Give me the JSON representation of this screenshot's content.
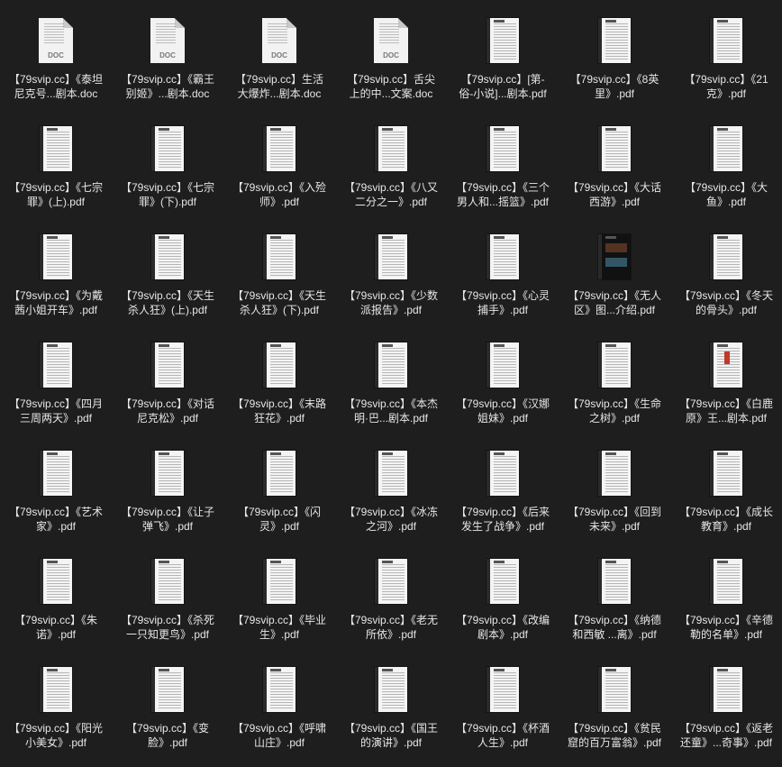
{
  "files": [
    {
      "name": "【79svip.cc】《泰坦\n尼克号...剧本.doc",
      "type": "doc",
      "tag": "DOC"
    },
    {
      "name": "【79svip.cc】《霸王\n别姬》...剧本.doc",
      "type": "doc",
      "tag": "DOC"
    },
    {
      "name": "【79svip.cc】生活\n大爆炸...剧本.doc",
      "type": "doc",
      "tag": "DOC"
    },
    {
      "name": "【79svip.cc】舌尖\n上的中...文案.doc",
      "type": "doc",
      "tag": "DOC"
    },
    {
      "name": "【79svip.cc】[第-\n俗-小说]...剧本.pdf",
      "type": "pdf"
    },
    {
      "name": "【79svip.cc】《8英\n里》.pdf",
      "type": "pdf"
    },
    {
      "name": "【79svip.cc】《21\n克》.pdf",
      "type": "pdf"
    },
    {
      "name": "【79svip.cc】《七宗\n罪》(上).pdf",
      "type": "pdf"
    },
    {
      "name": "【79svip.cc】《七宗\n罪》(下).pdf",
      "type": "pdf"
    },
    {
      "name": "【79svip.cc】《入殓\n师》.pdf",
      "type": "pdf"
    },
    {
      "name": "【79svip.cc】《八又\n二分之一》.pdf",
      "type": "pdf"
    },
    {
      "name": "【79svip.cc】《三个\n男人和...摇篮》.pdf",
      "type": "pdf"
    },
    {
      "name": "【79svip.cc】《大话\n西游》.pdf",
      "type": "pdf"
    },
    {
      "name": "【79svip.cc】《大\n鱼》.pdf",
      "type": "pdf"
    },
    {
      "name": "【79svip.cc】《为戴\n茜小姐开车》.pdf",
      "type": "pdf"
    },
    {
      "name": "【79svip.cc】《天生\n杀人狂》(上).pdf",
      "type": "pdf"
    },
    {
      "name": "【79svip.cc】《天生\n杀人狂》(下).pdf",
      "type": "pdf"
    },
    {
      "name": "【79svip.cc】《少数\n派报告》.pdf",
      "type": "pdf"
    },
    {
      "name": "【79svip.cc】《心灵\n捕手》.pdf",
      "type": "pdf"
    },
    {
      "name": "【79svip.cc】《无人\n区》图...介绍.pdf",
      "type": "pdf",
      "variant": "dark"
    },
    {
      "name": "【79svip.cc】《冬天\n的骨头》.pdf",
      "type": "pdf"
    },
    {
      "name": "【79svip.cc】《四月\n三周两天》.pdf",
      "type": "pdf"
    },
    {
      "name": "【79svip.cc】《对话\n尼克松》.pdf",
      "type": "pdf"
    },
    {
      "name": "【79svip.cc】《末路\n狂花》.pdf",
      "type": "pdf"
    },
    {
      "name": "【79svip.cc】《本杰\n明·巴...剧本.pdf",
      "type": "pdf"
    },
    {
      "name": "【79svip.cc】《汉娜\n姐妹》.pdf",
      "type": "pdf"
    },
    {
      "name": "【79svip.cc】《生命\n之树》.pdf",
      "type": "pdf"
    },
    {
      "name": "【79svip.cc】《白鹿\n原》王...剧本.pdf",
      "type": "pdf",
      "variant": "red"
    },
    {
      "name": "【79svip.cc】《艺术\n家》.pdf",
      "type": "pdf"
    },
    {
      "name": "【79svip.cc】《让子\n弹飞》.pdf",
      "type": "pdf"
    },
    {
      "name": "【79svip.cc】《闪\n灵》.pdf",
      "type": "pdf"
    },
    {
      "name": "【79svip.cc】《冰冻\n之河》.pdf",
      "type": "pdf"
    },
    {
      "name": "【79svip.cc】《后来\n发生了战争》.pdf",
      "type": "pdf"
    },
    {
      "name": "【79svip.cc】《回到\n未来》.pdf",
      "type": "pdf"
    },
    {
      "name": "【79svip.cc】《成长\n教育》.pdf",
      "type": "pdf"
    },
    {
      "name": "【79svip.cc】《朱\n诺》.pdf",
      "type": "pdf"
    },
    {
      "name": "【79svip.cc】《杀死\n一只知更鸟》.pdf",
      "type": "pdf"
    },
    {
      "name": "【79svip.cc】《毕业\n生》.pdf",
      "type": "pdf"
    },
    {
      "name": "【79svip.cc】《老无\n所依》.pdf",
      "type": "pdf"
    },
    {
      "name": "【79svip.cc】《改编\n剧本》.pdf",
      "type": "pdf"
    },
    {
      "name": "【79svip.cc】《纳德\n和西敏 ...离》.pdf",
      "type": "pdf"
    },
    {
      "name": "【79svip.cc】《辛德\n勒的名单》.pdf",
      "type": "pdf"
    },
    {
      "name": "【79svip.cc】《阳光\n小美女》.pdf",
      "type": "pdf"
    },
    {
      "name": "【79svip.cc】《变\n脸》.pdf",
      "type": "pdf"
    },
    {
      "name": "【79svip.cc】《呼啸\n山庄》.pdf",
      "type": "pdf"
    },
    {
      "name": "【79svip.cc】《国王\n的演讲》.pdf",
      "type": "pdf"
    },
    {
      "name": "【79svip.cc】《杯酒\n人生》.pdf",
      "type": "pdf"
    },
    {
      "name": "【79svip.cc】《贫民\n窟的百万富翁》.pdf",
      "type": "pdf"
    },
    {
      "name": "【79svip.cc】《返老\n还童》...奇事》.pdf",
      "type": "pdf"
    }
  ]
}
